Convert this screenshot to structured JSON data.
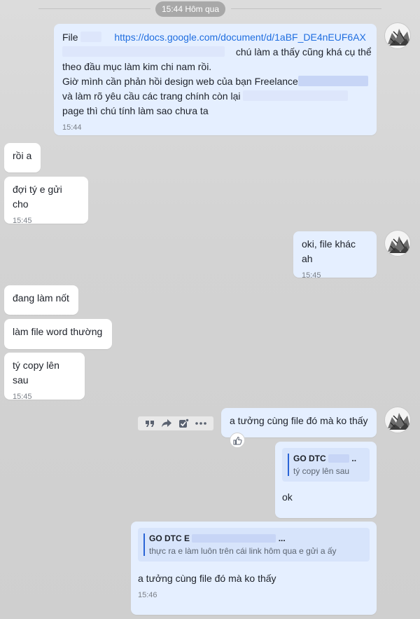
{
  "date_separator": "15:44 Hôm qua",
  "messages": [
    {
      "file_label": "File",
      "link": "https://docs.google.com/document/d/1aBF_DE4nEUF6AX",
      "line2": "chú làm a thấy cũng khá cụ thể",
      "line3": "theo đầu mục làm kim chi nam rồi.",
      "line4": "Giờ mình cần phản hồi design web của bạn Freelance",
      "line5": " và làm rõ yêu cầu các trang chính còn lại",
      "line6": "page thì chú tính làm sao chưa ta",
      "time": "15:44"
    },
    {
      "text": "rồi a"
    },
    {
      "text": "đợi tý e gửi cho",
      "time": "15:45"
    },
    {
      "text": "oki, file khác ah",
      "time": "15:45"
    },
    {
      "text": "đang làm nốt"
    },
    {
      "text": "làm file word thường"
    },
    {
      "text": "tý copy lên sau",
      "time": "15:45"
    },
    {
      "text": "a tưởng cùng file đó mà ko thấy"
    },
    {
      "quote_name": "GO DTC",
      "quote_name_suffix": "..",
      "quote_text": "tý copy lên sau",
      "text": "ok"
    },
    {
      "quote_name": "GO DTC E",
      "quote_name_suffix": "...",
      "quote_text": "thực ra e làm luôn trên cái link hôm qua e gửi a ấy",
      "text": "a tưởng cùng file đó mà ko thấy",
      "time": "15:46"
    }
  ],
  "colors": {
    "outgoing": "#e5efff",
    "incoming": "#ffffff",
    "link": "#1f6ee0",
    "accent": "#2a64d6"
  },
  "icons": [
    "quote-icon",
    "forward-icon",
    "task-icon",
    "more-icon",
    "like-icon",
    "avatar"
  ]
}
